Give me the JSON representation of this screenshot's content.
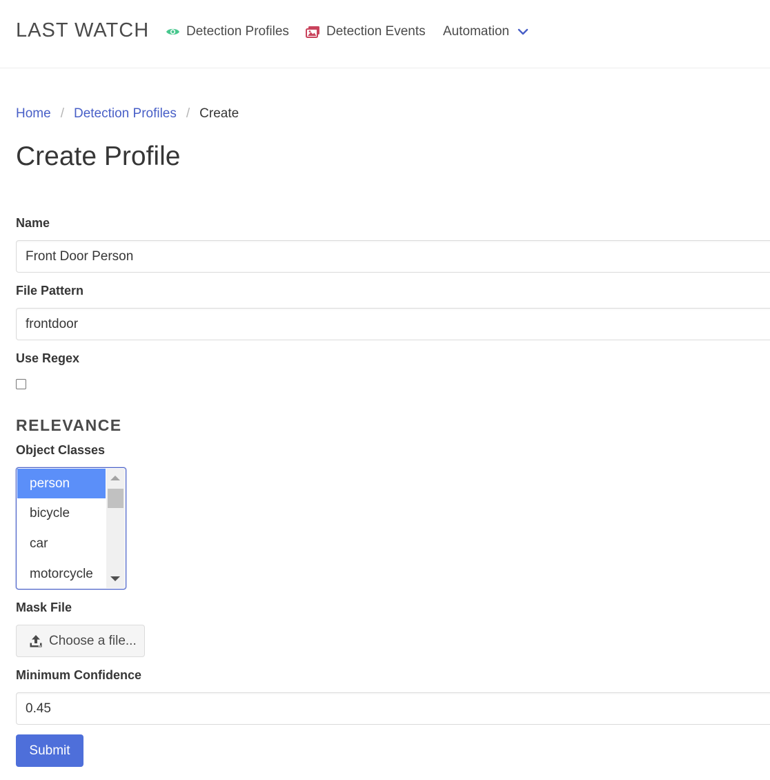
{
  "navbar": {
    "brand": "LAST WATCH",
    "items": [
      {
        "label": "Detection Profiles",
        "icon": "eye-icon"
      },
      {
        "label": "Detection Events",
        "icon": "images-icon"
      },
      {
        "label": "Automation",
        "icon": "chevron-down-icon"
      }
    ]
  },
  "breadcrumb": {
    "home": "Home",
    "section": "Detection Profiles",
    "current": "Create",
    "separator": "/"
  },
  "page": {
    "title": "Create Profile"
  },
  "form": {
    "name": {
      "label": "Name",
      "value": "Front Door Person"
    },
    "file_pattern": {
      "label": "File Pattern",
      "value": "frontdoor"
    },
    "use_regex": {
      "label": "Use Regex",
      "checked": false
    },
    "relevance_heading": "RELEVANCE",
    "object_classes": {
      "label": "Object Classes",
      "options": [
        "person",
        "bicycle",
        "car",
        "motorcycle"
      ],
      "selected": "person"
    },
    "mask_file": {
      "label": "Mask File",
      "button_label": "Choose a file...",
      "icon": "upload-icon"
    },
    "min_confidence": {
      "label": "Minimum Confidence",
      "value": "0.45"
    },
    "submit_label": "Submit"
  },
  "colors": {
    "link": "#485fc7",
    "primary_button": "#4e6fda",
    "selected_option": "#5b8ff9",
    "eye_icon": "#48c78e",
    "images_icon": "#c9435c"
  }
}
